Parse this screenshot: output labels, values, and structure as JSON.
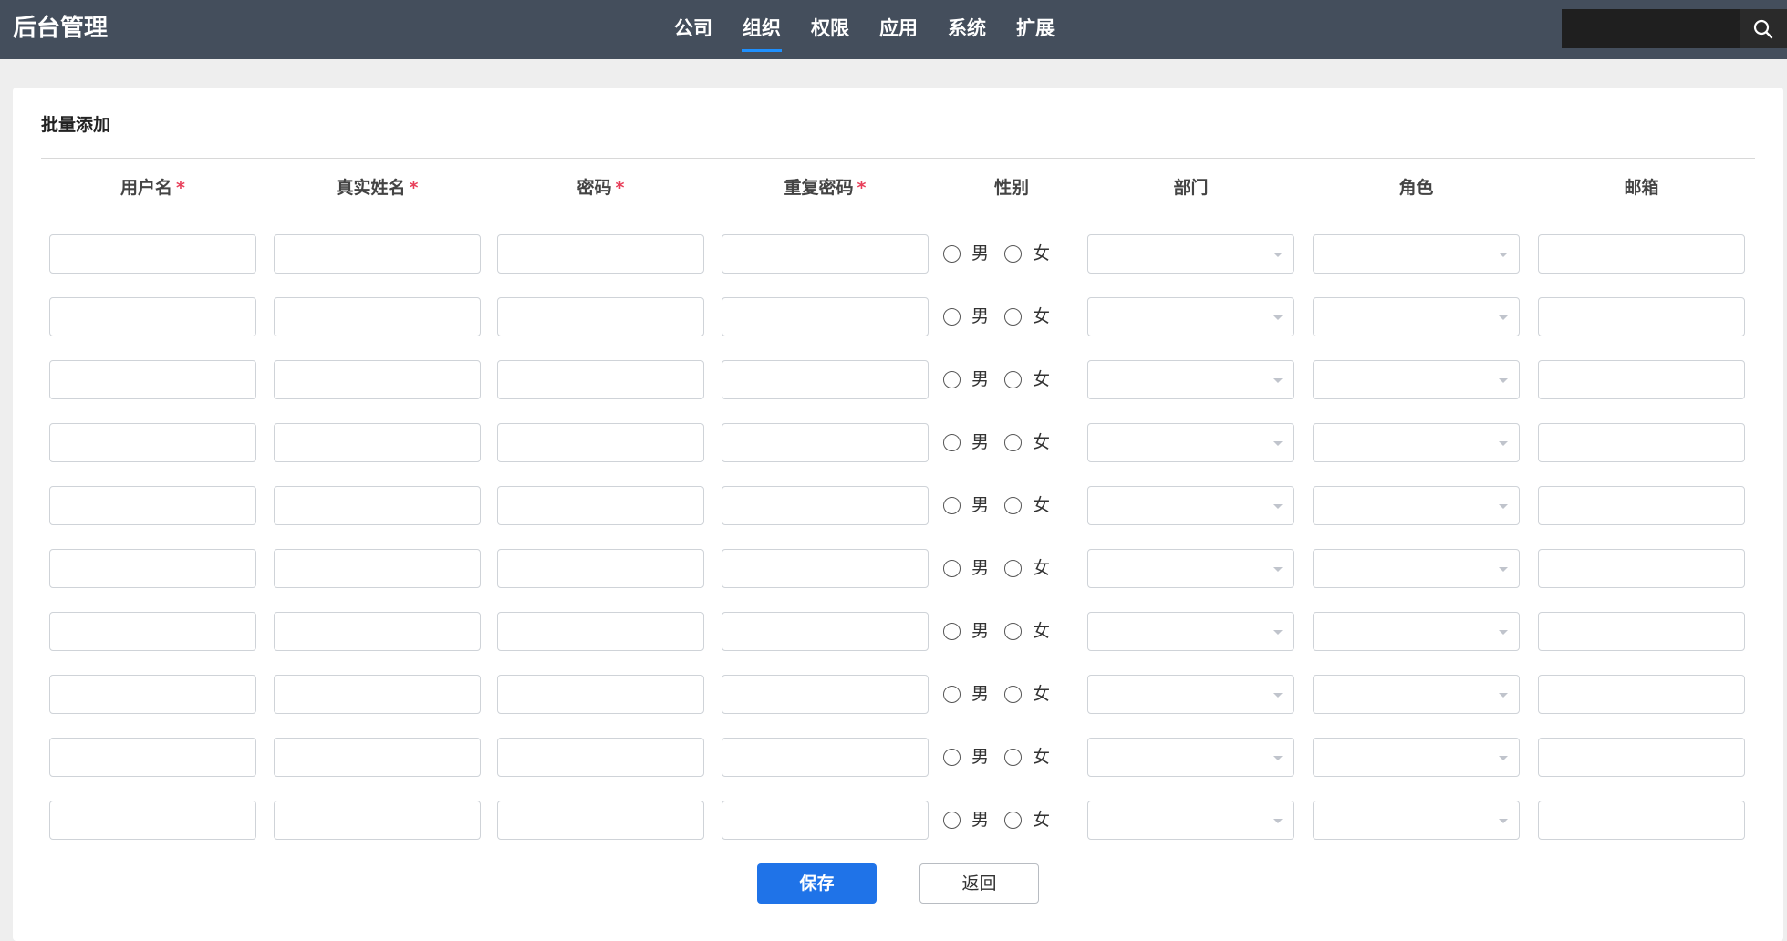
{
  "header": {
    "brand": "后台管理",
    "nav": [
      {
        "label": "公司",
        "active": false
      },
      {
        "label": "组织",
        "active": true
      },
      {
        "label": "权限",
        "active": false
      },
      {
        "label": "应用",
        "active": false
      },
      {
        "label": "系统",
        "active": false
      },
      {
        "label": "扩展",
        "active": false
      }
    ],
    "search": {
      "value": "",
      "icon": "search-icon"
    }
  },
  "form": {
    "title": "批量添加",
    "columns": [
      {
        "label": "用户名",
        "required": true
      },
      {
        "label": "真实姓名",
        "required": true
      },
      {
        "label": "密码",
        "required": true
      },
      {
        "label": "重复密码",
        "required": true
      },
      {
        "label": "性别",
        "required": false
      },
      {
        "label": "部门",
        "required": false
      },
      {
        "label": "角色",
        "required": false
      },
      {
        "label": "邮箱",
        "required": false
      }
    ],
    "required_mark": "*",
    "gender_options": [
      "男",
      "女"
    ],
    "row_count": 10,
    "buttons": {
      "save": "保存",
      "back": "返回"
    }
  },
  "colors": {
    "topbar": "#444e5c",
    "accent": "#1f73e8",
    "required": "#e8405b"
  }
}
